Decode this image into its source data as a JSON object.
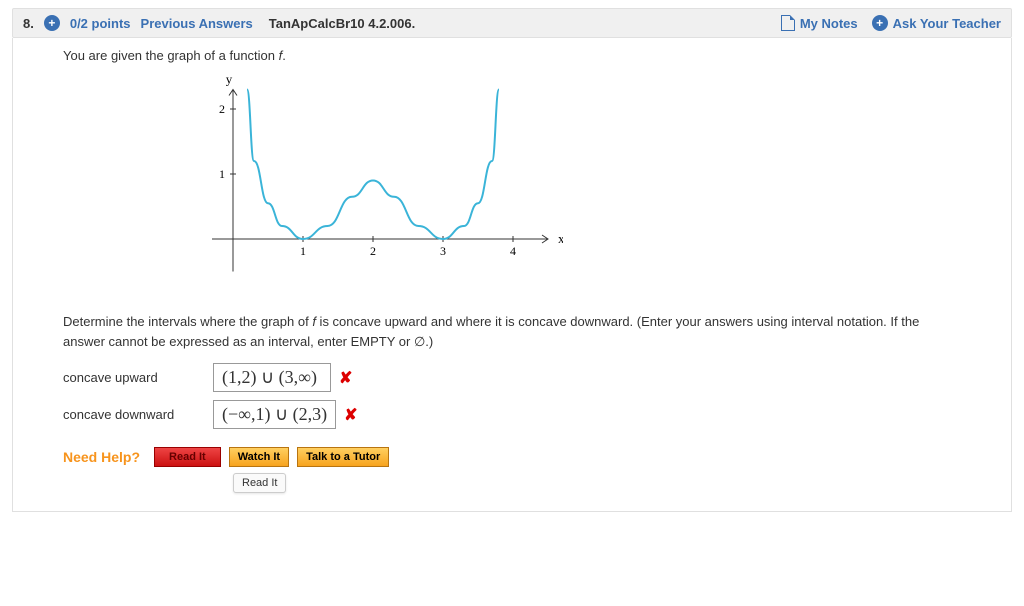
{
  "header": {
    "question_number": "8.",
    "points": "0/2 points",
    "previous_answers": "Previous Answers",
    "question_id": "TanApCalcBr10 4.2.006.",
    "my_notes": "My Notes",
    "ask_teacher": "Ask Your Teacher"
  },
  "prompt_intro": "You are given the graph of a function ",
  "prompt_fvar": "f",
  "instruction_1": "Determine the intervals where the graph of ",
  "instruction_2": " is concave upward and where it is concave downward. (Enter your answers using interval notation. If the answer cannot be expressed as an interval, enter EMPTY or ∅.)",
  "answers": {
    "upward_label": "concave upward",
    "upward_value": "(1,2) ∪ (3,∞)",
    "downward_label": "concave downward",
    "downward_value": "(−∞,1) ∪ (2,3)"
  },
  "help": {
    "need_help": "Need Help?",
    "read_it": "Read It",
    "watch_it": "Watch It",
    "talk_tutor": "Talk to a Tutor",
    "tooltip": "Read It"
  },
  "chart_data": {
    "type": "line",
    "title": "",
    "xlabel": "x",
    "ylabel": "y",
    "xlim": [
      -0.3,
      4.5
    ],
    "ylim": [
      -0.5,
      2.3
    ],
    "x_ticks": [
      1,
      2,
      3,
      4
    ],
    "y_ticks": [
      1,
      2
    ],
    "series": [
      {
        "name": "f",
        "points": [
          [
            0.2,
            2.3
          ],
          [
            0.3,
            1.2
          ],
          [
            0.5,
            0.55
          ],
          [
            0.7,
            0.2
          ],
          [
            1.0,
            0.0
          ],
          [
            1.35,
            0.2
          ],
          [
            1.7,
            0.65
          ],
          [
            2.0,
            0.9
          ],
          [
            2.3,
            0.65
          ],
          [
            2.65,
            0.2
          ],
          [
            3.0,
            0.0
          ],
          [
            3.3,
            0.2
          ],
          [
            3.5,
            0.55
          ],
          [
            3.7,
            1.2
          ],
          [
            3.8,
            2.3
          ]
        ]
      }
    ]
  }
}
